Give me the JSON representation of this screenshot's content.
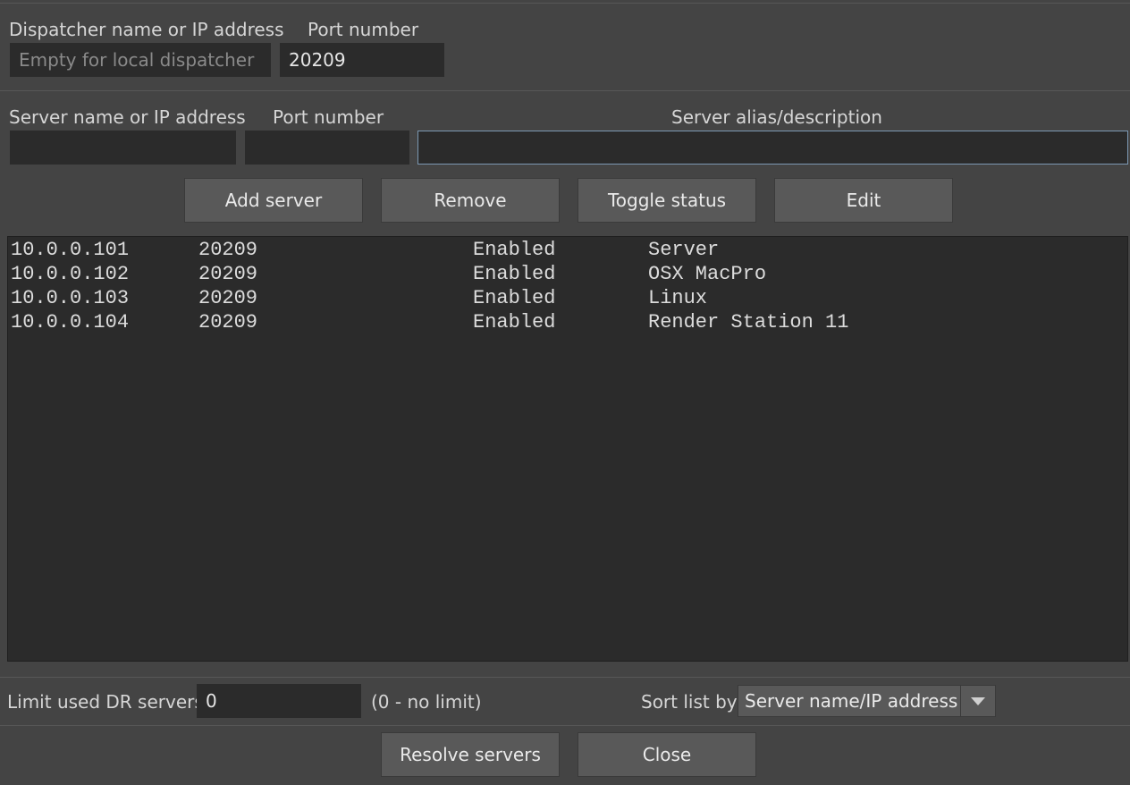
{
  "dispatcher": {
    "name_label": "Dispatcher name or IP address",
    "name_placeholder": "Empty for local dispatcher",
    "port_label": "Port number",
    "port_value": "20209"
  },
  "server_entry": {
    "name_label": "Server name or IP address",
    "port_label": "Port number",
    "alias_label": "Server alias/description"
  },
  "buttons": {
    "add": "Add server",
    "remove": "Remove",
    "toggle": "Toggle status",
    "edit": "Edit",
    "resolve": "Resolve servers",
    "close": "Close"
  },
  "servers": [
    {
      "address": "10.0.0.101",
      "port": "20209",
      "status": "Enabled",
      "alias": "Server"
    },
    {
      "address": "10.0.0.102",
      "port": "20209",
      "status": "Enabled",
      "alias": "OSX MacPro"
    },
    {
      "address": "10.0.0.103",
      "port": "20209",
      "status": "Enabled",
      "alias": "Linux"
    },
    {
      "address": "10.0.0.104",
      "port": "20209",
      "status": "Enabled",
      "alias": "Render Station 11"
    }
  ],
  "footer": {
    "limit_label": "Limit used DR servers",
    "limit_value": "0",
    "limit_hint": "(0 - no limit)",
    "sort_label": "Sort list by",
    "sort_value": "Server name/IP address"
  },
  "colors": {
    "background": "#444444",
    "field": "#2b2b2b",
    "button": "#595959",
    "focus_border": "#7c98b3"
  }
}
